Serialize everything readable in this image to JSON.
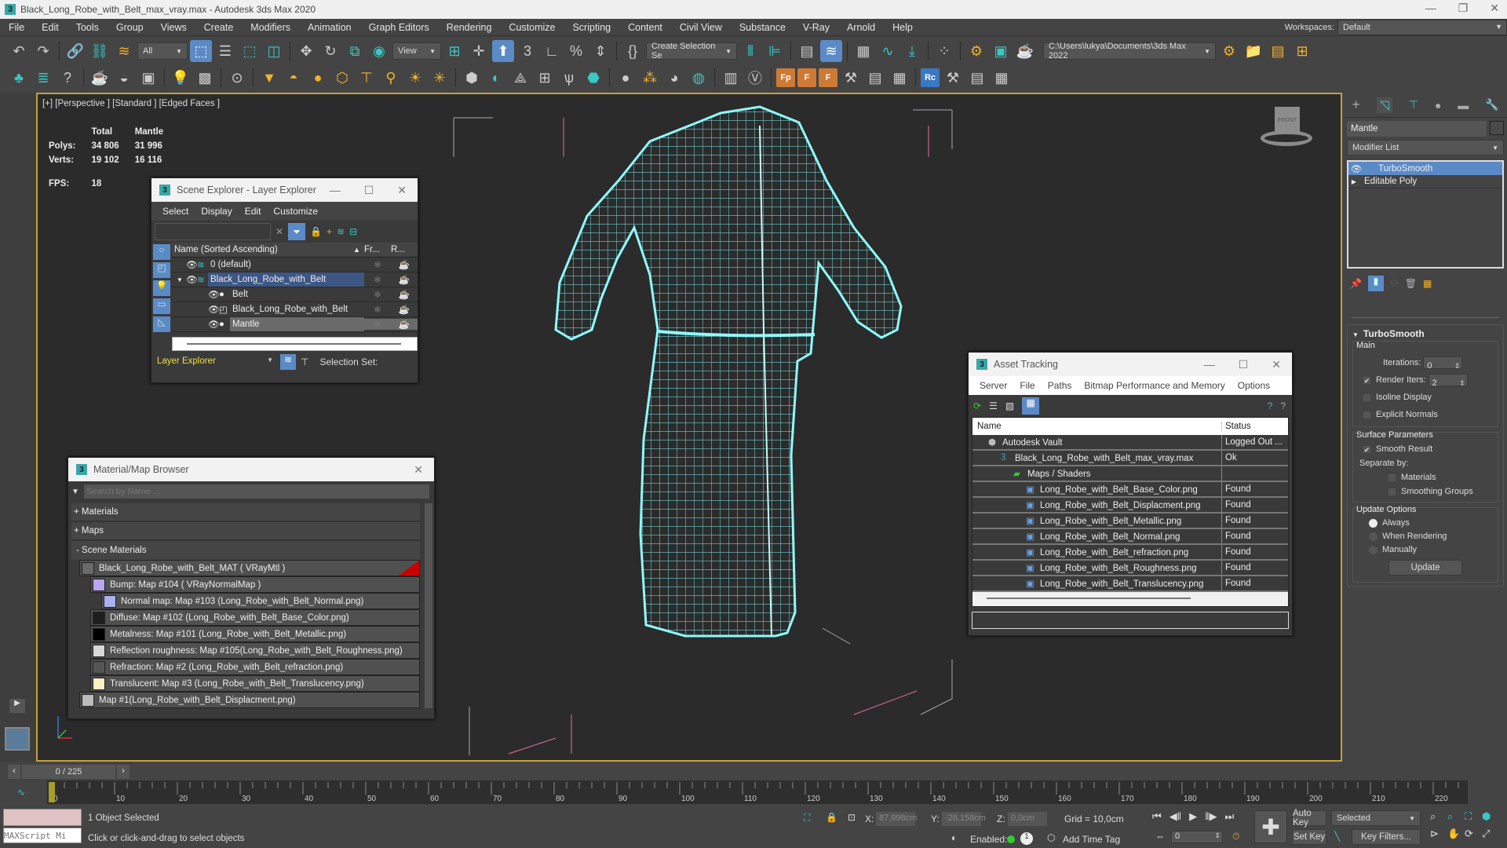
{
  "window": {
    "title": "Black_Long_Robe_with_Belt_max_vray.max - Autodesk 3ds Max 2020",
    "app_icon": "3",
    "controls": [
      "minimize-icon",
      "maximize-icon",
      "close-icon"
    ]
  },
  "menu": {
    "items": [
      "File",
      "Edit",
      "Tools",
      "Group",
      "Views",
      "Create",
      "Modifiers",
      "Animation",
      "Graph Editors",
      "Rendering",
      "Customize",
      "Scripting",
      "Content",
      "Civil View",
      "Substance",
      "V-Ray",
      "Arnold",
      "Help"
    ],
    "workspaces_label": "Workspaces:",
    "workspace_value": "Default"
  },
  "toolbar": {
    "selection_filter": "All",
    "ref_coord": "View",
    "named_selection": "Create Selection Se",
    "project_path": "C:\\Users\\lukya\\Documents\\3ds Max 2022"
  },
  "viewport": {
    "label": "[+] [Perspective ] [Standard ] [Edged Faces ]",
    "stats": {
      "col_total": "Total",
      "col_object": "Mantle",
      "polys_label": "Polys:",
      "polys_total": "34 806",
      "polys_object": "31 996",
      "verts_label": "Verts:",
      "verts_total": "19 102",
      "verts_object": "16 116",
      "fps_label": "FPS:",
      "fps_value": "18"
    },
    "viewcube_label": "FRONT",
    "wire_color": "#7ff3f6"
  },
  "scene_explorer": {
    "title": "Scene Explorer - Layer Explorer",
    "menu": [
      "Select",
      "Display",
      "Edit",
      "Customize"
    ],
    "col_name": "Name (Sorted Ascending)",
    "col_freeze": "Fr...",
    "col_render": "R...",
    "rows": [
      {
        "name": "0 (default)",
        "indent": 0,
        "type": "layer"
      },
      {
        "name": "Black_Long_Robe_with_Belt",
        "indent": 0,
        "type": "layer",
        "expanded": true,
        "highlight": true
      },
      {
        "name": "Belt",
        "indent": 1,
        "type": "object"
      },
      {
        "name": "Black_Long_Robe_with_Belt",
        "indent": 1,
        "type": "group"
      },
      {
        "name": "Mantle",
        "indent": 1,
        "type": "object",
        "selected": true
      }
    ],
    "footer_mode": "Layer Explorer",
    "selection_set_label": "Selection Set:"
  },
  "material_browser": {
    "title": "Material/Map Browser",
    "search_placeholder": "Search by Name ...",
    "groups": [
      "+ Materials",
      "+ Maps",
      "- Scene Materials"
    ],
    "items": [
      {
        "label": "Black_Long_Robe_with_Belt_MAT  ( VRayMtl )",
        "level": 0,
        "swatch": "#6a6a6a"
      },
      {
        "label": "Bump: Map #104  ( VRayNormalMap )",
        "level": 1,
        "swatch": "#b9a6f0"
      },
      {
        "label": "Normal map: Map #103 (Long_Robe_with_Belt_Normal.png)",
        "level": 2,
        "swatch": "#aab0f0"
      },
      {
        "label": "Diffuse: Map #102 (Long_Robe_with_Belt_Base_Color.png)",
        "level": 1,
        "swatch": "#1e1e1e"
      },
      {
        "label": "Metalness: Map #101 (Long_Robe_with_Belt_Metallic.png)",
        "level": 1,
        "swatch": "#000000"
      },
      {
        "label": "Reflection roughness: Map #105(Long_Robe_with_Belt_Roughness.png)",
        "level": 1,
        "swatch": "#d8d8d8"
      },
      {
        "label": "Refraction: Map #2 (Long_Robe_with_Belt_refraction.png)",
        "level": 1,
        "swatch": "#555555"
      },
      {
        "label": "Translucent: Map #3 (Long_Robe_with_Belt_Translucency.png)",
        "level": 1,
        "swatch": "#fbefc4"
      },
      {
        "label": "Map #1(Long_Robe_with_Belt_Displacment.png)",
        "level": 0,
        "swatch": "#bbbbbb"
      }
    ]
  },
  "asset_tracking": {
    "title": "Asset Tracking",
    "menu": [
      "Server",
      "File",
      "Paths",
      "Bitmap Performance and Memory",
      "Options"
    ],
    "col_name": "Name",
    "col_status": "Status",
    "rows": [
      {
        "name": "Autodesk Vault",
        "status": "Logged Out ...",
        "level": 0
      },
      {
        "name": "Black_Long_Robe_with_Belt_max_vray.max",
        "status": "Ok",
        "level": 1
      },
      {
        "name": "Maps / Shaders",
        "status": "",
        "level": 2
      },
      {
        "name": "Long_Robe_with_Belt_Base_Color.png",
        "status": "Found",
        "level": 3
      },
      {
        "name": "Long_Robe_with_Belt_Displacment.png",
        "status": "Found",
        "level": 3
      },
      {
        "name": "Long_Robe_with_Belt_Metallic.png",
        "status": "Found",
        "level": 3
      },
      {
        "name": "Long_Robe_with_Belt_Normal.png",
        "status": "Found",
        "level": 3
      },
      {
        "name": "Long_Robe_with_Belt_refraction.png",
        "status": "Found",
        "level": 3
      },
      {
        "name": "Long_Robe_with_Belt_Roughness.png",
        "status": "Found",
        "level": 3
      },
      {
        "name": "Long_Robe_with_Belt_Translucency.png",
        "status": "Found",
        "level": 3
      }
    ]
  },
  "command_panel": {
    "object_name": "Mantle",
    "modifier_list": "Modifier List",
    "stack": [
      {
        "name": "TurboSmooth",
        "active": true
      },
      {
        "name": "Editable Poly",
        "active": false
      }
    ],
    "rollout_title": "TurboSmooth",
    "main_group": "Main",
    "iterations_label": "Iterations:",
    "iterations_value": "0",
    "render_iters_label": "Render Iters:",
    "render_iters_value": "2",
    "render_iters_checked": true,
    "isoline_label": "Isoline Display",
    "explicit_normals_label": "Explicit Normals",
    "surface_group": "Surface Parameters",
    "smooth_result_label": "Smooth Result",
    "separate_by_label": "Separate by:",
    "materials_label": "Materials",
    "smoothing_groups_label": "Smoothing Groups",
    "update_group": "Update Options",
    "update_options": [
      "Always",
      "When Rendering",
      "Manually"
    ],
    "update_selected": "Always",
    "update_button": "Update"
  },
  "timeline": {
    "frame_display": "0 / 225",
    "current_frame": 0,
    "total_frames": 225,
    "ticks": [
      "0",
      "10",
      "20",
      "30",
      "40",
      "50",
      "60",
      "70",
      "80",
      "90",
      "100",
      "110",
      "120",
      "130",
      "140",
      "150",
      "160",
      "170",
      "180",
      "190",
      "200",
      "210",
      "220"
    ]
  },
  "status": {
    "maxscript_placeholder": "MAXScript Mi",
    "selection_text": "1 Object Selected",
    "prompt_text": "Click or click-and-drag to select objects",
    "x_label": "X:",
    "x_value": "87,998cm",
    "y_label": "Y:",
    "y_value": "-28,158cm",
    "z_label": "Z:",
    "z_value": "0,0cm",
    "grid": "Grid = 10,0cm",
    "enabled_label": "Enabled:",
    "add_time_tag": "Add Time Tag",
    "frame_spinner": "0",
    "auto_key": "Auto Key",
    "set_key": "Set Key",
    "key_mode": "Selected",
    "key_filters": "Key Filters..."
  }
}
